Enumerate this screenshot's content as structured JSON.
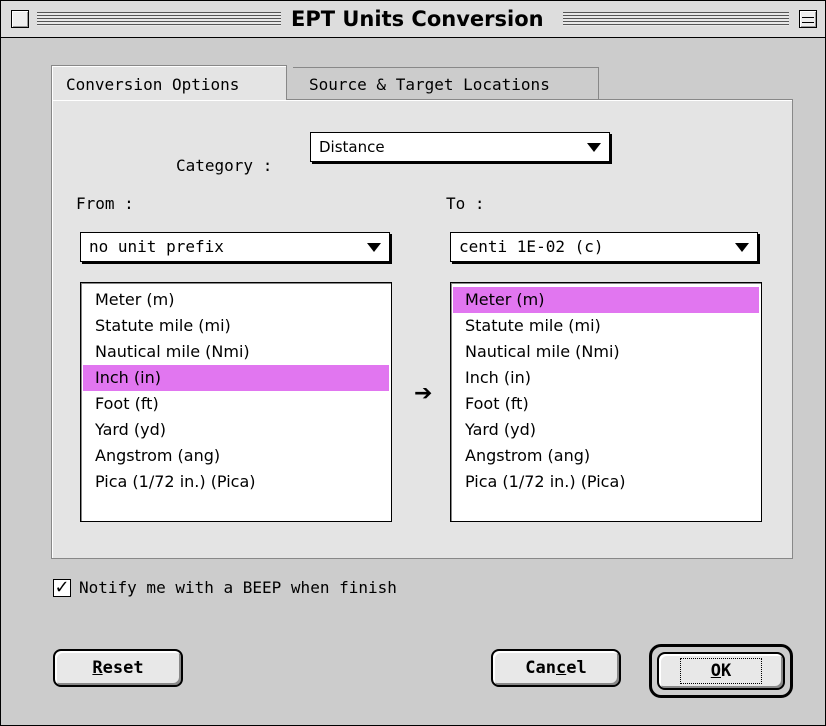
{
  "window": {
    "title": "EPT Units Conversion"
  },
  "tabs": [
    {
      "label": "Conversion Options",
      "active": true
    },
    {
      "label": "Source & Target Locations",
      "active": false
    }
  ],
  "category": {
    "label": "Category :",
    "value": "Distance"
  },
  "from": {
    "label": "From :",
    "prefix": "no unit prefix",
    "units": [
      "Meter (m)",
      "Statute mile (mi)",
      "Nautical mile (Nmi)",
      "Inch (in)",
      "Foot (ft)",
      "Yard (yd)",
      "Angstrom (ang)",
      "Pica (1/72 in.) (Pica)"
    ],
    "selected_index": 3
  },
  "to": {
    "label": "To :",
    "prefix": "centi 1E-02 (c)",
    "units": [
      "Meter (m)",
      "Statute mile (mi)",
      "Nautical mile (Nmi)",
      "Inch (in)",
      "Foot (ft)",
      "Yard (yd)",
      "Angstrom (ang)",
      "Pica (1/72 in.) (Pica)"
    ],
    "selected_index": 0
  },
  "arrow_glyph": "➔",
  "notify": {
    "label": "Notify me with a BEEP when finish",
    "checked": true
  },
  "buttons": {
    "reset": {
      "underlined": "R",
      "rest": "eset"
    },
    "cancel": {
      "before": "Can",
      "underlined": "c",
      "after": "el"
    },
    "ok": {
      "underlined": "O",
      "rest": "K"
    }
  },
  "colors": {
    "selection": "#e176f0",
    "window_bg": "#cccccc",
    "panel_bg": "#e4e4e4"
  }
}
